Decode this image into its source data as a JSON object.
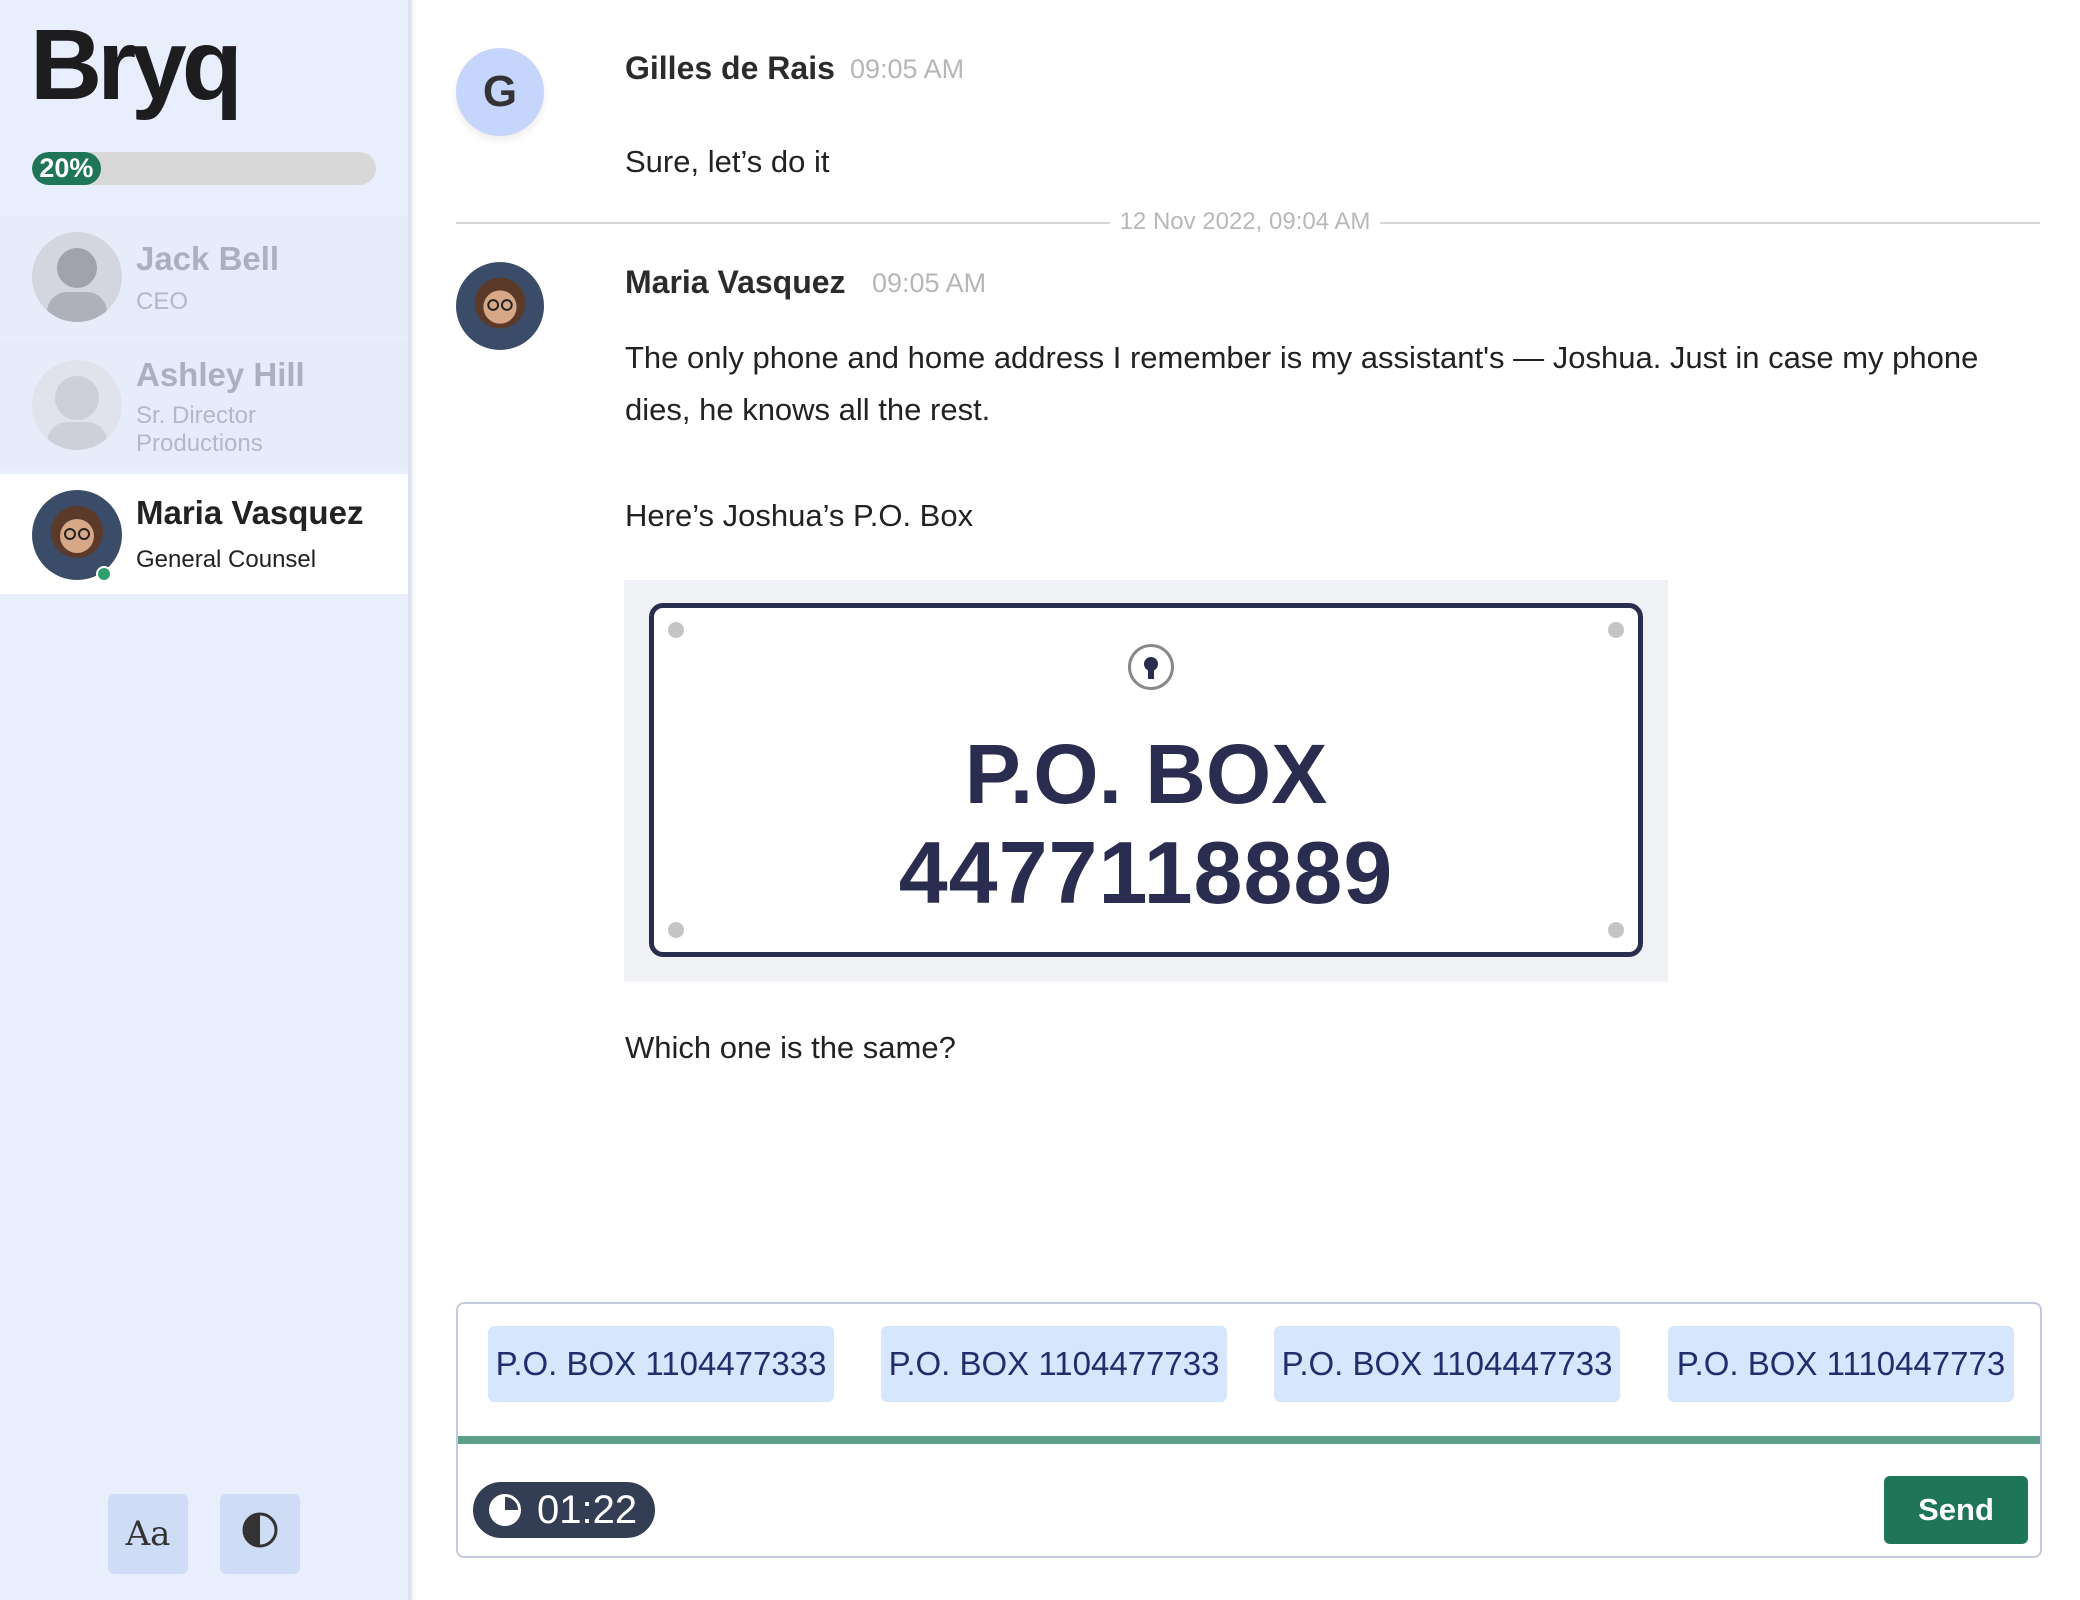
{
  "brand": "Bryq",
  "progress": {
    "percent_label": "20%",
    "value": 0.2
  },
  "contacts": [
    {
      "name": "Jack Bell",
      "title": "CEO",
      "state": "dim"
    },
    {
      "name": "Ashley Hill",
      "title": "Sr. Director Productions",
      "state": "dim"
    },
    {
      "name": "Maria Vasquez",
      "title": "General Counsel",
      "state": "active",
      "online": true
    }
  ],
  "tools": {
    "font_label": "Aa",
    "contrast_icon": "contrast-icon"
  },
  "messages": [
    {
      "avatar_letter": "G",
      "sender": "Gilles de Rais",
      "time": "09:05 AM",
      "text": "Sure, let’s do it"
    },
    {
      "sender": "Maria Vasquez",
      "time": "09:05 AM",
      "text": "The only phone and home address I remember is my assistant's — Joshua. Just in case my phone dies, he knows all the rest.",
      "text2": "Here’s Joshua’s P.O. Box",
      "po_box": {
        "title": "P.O. BOX",
        "number": "4477118889"
      },
      "question": "Which one is the same?"
    }
  ],
  "divider_label": "12 Nov 2022, 09:04 AM",
  "answers": {
    "options": [
      "P.O. BOX 1104477333",
      "P.O. BOX 1104477733",
      "P.O. BOX 1104447733",
      "P.O. BOX 1110447773"
    ],
    "timer": "01:22",
    "send_label": "Send"
  },
  "colors": {
    "accent": "#1e7558",
    "sidebar": "#e9eefd",
    "option_bg": "#d6e6fd",
    "plate": "#2a2d4f"
  }
}
